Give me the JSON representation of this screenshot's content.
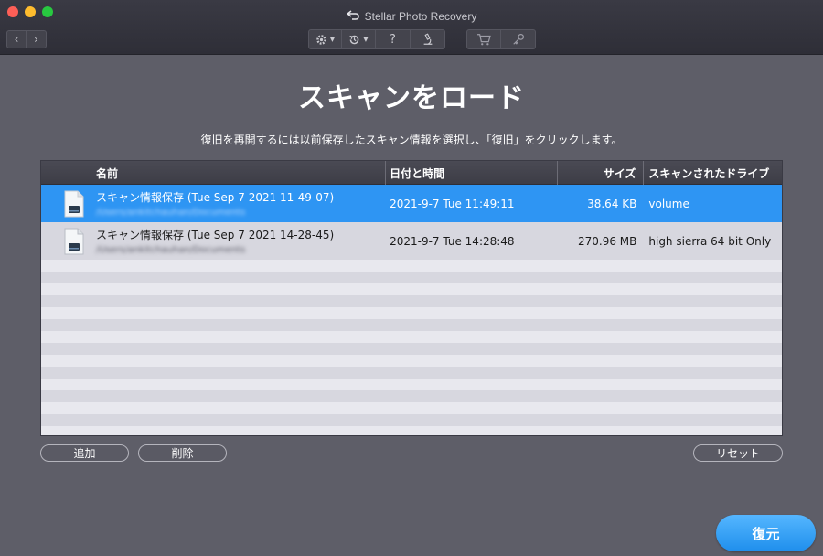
{
  "window": {
    "title": "Stellar Photo Recovery"
  },
  "icons": {
    "back": "back-arrow-icon",
    "settings": "gear-icon",
    "history": "history-icon",
    "help": "question-icon",
    "scan": "microscope-icon",
    "cart": "cart-icon",
    "key": "key-icon",
    "file": "document-icon"
  },
  "toolbar": {
    "help_glyph": "?",
    "nav_back": "‹",
    "nav_forward": "›"
  },
  "page": {
    "title": "スキャンをロード",
    "instructions": "復旧を再開するには以前保存したスキャン情報を選択し、「復旧」をクリックします。"
  },
  "table": {
    "columns": {
      "name": "名前",
      "date": "日付と時間",
      "size": "サイズ",
      "drive": "スキャンされたドライブ"
    },
    "rows": [
      {
        "name": "スキャン情報保存 (Tue Sep 7 2021 11-49-07)",
        "path": "/Users/ankitchauhan/Documents",
        "date": "2021-9-7 Tue 11:49:11",
        "size": "38.64 KB",
        "drive": "volume",
        "selected": true
      },
      {
        "name": "スキャン情報保存 (Tue Sep 7 2021 14-28-45)",
        "path": "/Users/ankitchauhan/Documents",
        "date": "2021-9-7 Tue 14:28:48",
        "size": "270.96 MB",
        "drive": "high sierra 64 bit Only",
        "selected": false
      }
    ]
  },
  "buttons": {
    "add": "追加",
    "delete": "削除",
    "reset": "リセット",
    "recover": "復元"
  },
  "colors": {
    "selection": "#2e95f3",
    "recover_button": "#2e95f3",
    "background": "#5e5e68"
  }
}
